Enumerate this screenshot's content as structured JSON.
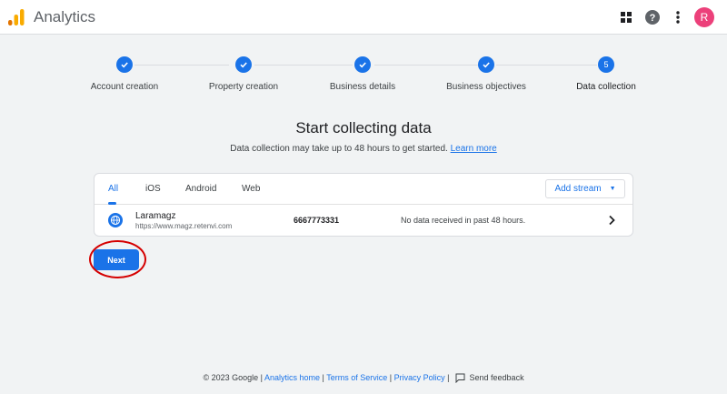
{
  "app": {
    "title": "Analytics"
  },
  "header": {
    "avatar_letter": "R"
  },
  "stepper": {
    "steps": [
      {
        "label": "Account creation",
        "state": "done"
      },
      {
        "label": "Property creation",
        "state": "done"
      },
      {
        "label": "Business details",
        "state": "done"
      },
      {
        "label": "Business objectives",
        "state": "done"
      },
      {
        "label": "Data collection",
        "state": "active",
        "number": "5"
      }
    ]
  },
  "main": {
    "title": "Start collecting data",
    "subtitle": "Data collection may take up to 48 hours to get started.",
    "learn_more": "Learn more"
  },
  "streams": {
    "tabs": [
      "All",
      "iOS",
      "Android",
      "Web"
    ],
    "active_tab": "All",
    "add_stream_label": "Add stream",
    "rows": [
      {
        "name": "Laramagz",
        "url": "https://www.magz.retenvi.com",
        "id": "6667773331",
        "status": "No data received in past 48 hours."
      }
    ]
  },
  "actions": {
    "next_label": "Next"
  },
  "footer": {
    "copyright": "© 2023 Google |",
    "analytics_home": "Analytics home",
    "terms": "Terms of Service",
    "privacy": "Privacy Policy",
    "feedback": "Send feedback"
  },
  "colors": {
    "accent": "#1a73e8",
    "annotation": "#d50000",
    "avatar": "#ec407a",
    "logo_orange": "#f9ab00",
    "logo_dark_orange": "#e37400"
  }
}
